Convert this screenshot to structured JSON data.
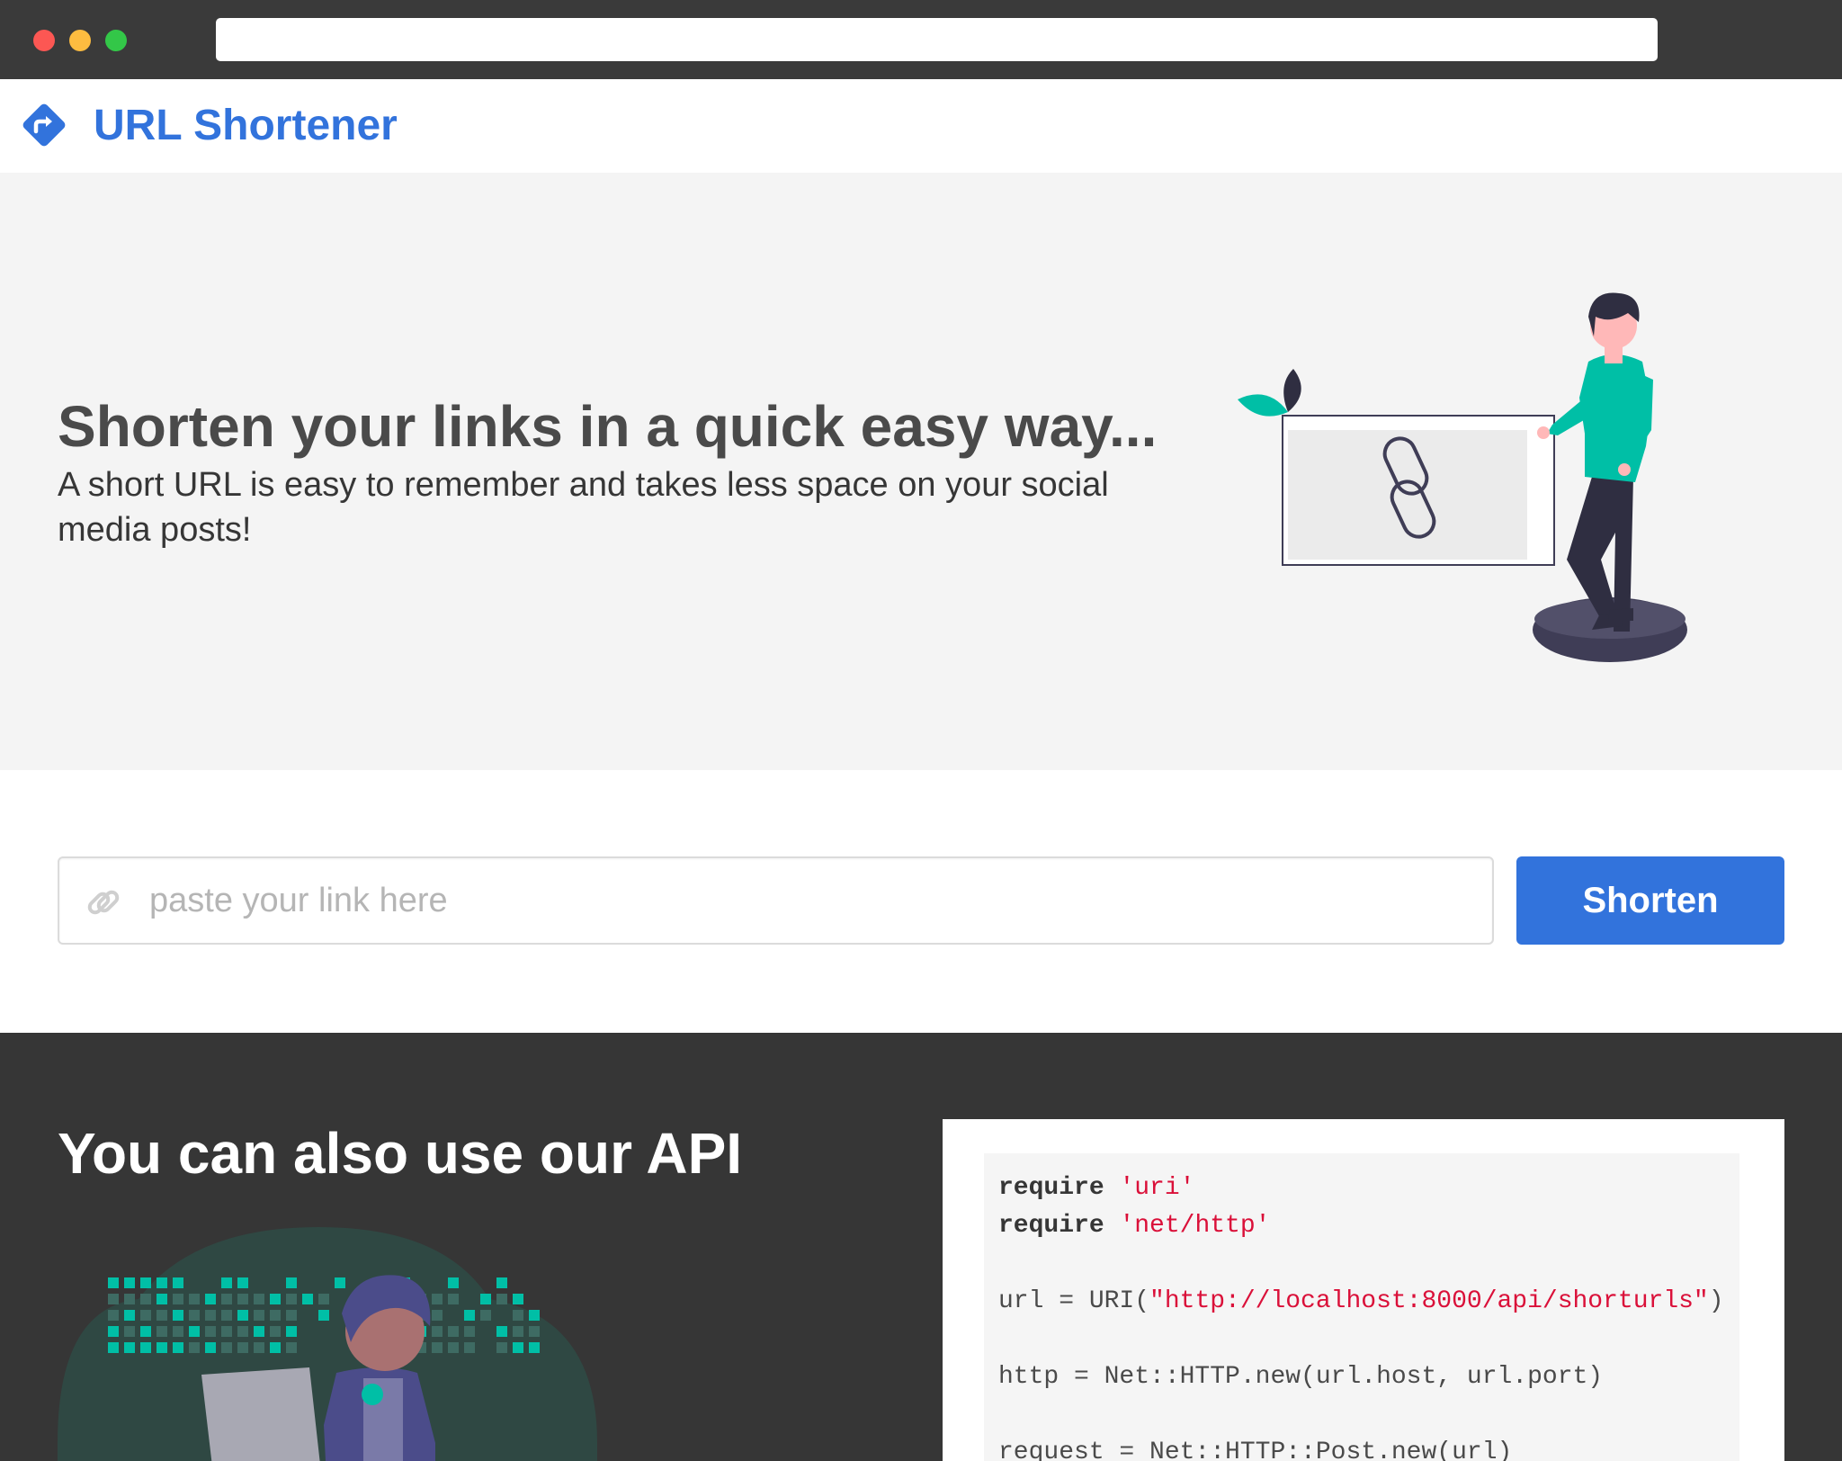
{
  "browser": {
    "address_value": ""
  },
  "navbar": {
    "brand": "URL Shortener",
    "logo_icon": "directions-diamond-icon",
    "brand_color": "#3273dc"
  },
  "hero": {
    "title": "Shorten your links in a quick easy way...",
    "subtitle": "A short URL is easy to remember and takes less space on your social media posts!"
  },
  "form": {
    "input_placeholder": "paste your link here",
    "input_value": "",
    "input_icon": "link-icon",
    "button_label": "Shorten"
  },
  "api": {
    "title": "You can also use our API",
    "code": {
      "line1_kw": "require",
      "line1_str": "'uri'",
      "line2_kw": "require",
      "line2_str": "'net/http'",
      "line4_pre": "url = URI(",
      "line4_str": "\"http://localhost:8000/api/shorturls\"",
      "line4_post": ")",
      "line6": "http = Net::HTTP.new(url.host, url.port)",
      "line8": "request = Net::HTTP::Post.new(url)"
    }
  },
  "colors": {
    "accent": "#3273dc",
    "hero_bg": "#f4f4f4",
    "api_bg": "#363636",
    "illustration_green": "#00bfa6",
    "code_string": "#da1039"
  }
}
